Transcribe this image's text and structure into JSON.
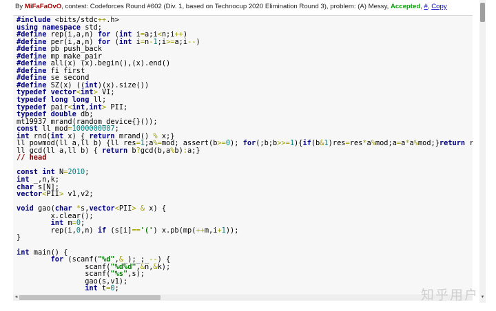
{
  "header": {
    "by_label": "By ",
    "username": "MiFaFaOvO",
    "contest_text": ", contest: Codeforces Round #602 (Div. 1, based on Technocup 2020 Elimination Round 3), problem: (A) Messy, ",
    "verdict": "Accepted",
    "sep1": ", ",
    "hash_link": "#",
    "sep2": ", ",
    "copy_link": "Copy"
  },
  "code_lines": [
    [
      [
        "pp",
        "#include"
      ],
      [
        "t",
        " <bits/stdc"
      ],
      [
        "op",
        "++"
      ],
      [
        "t",
        ".h>"
      ]
    ],
    [
      [
        "kw",
        "using namespace"
      ],
      [
        "t",
        " std;"
      ]
    ],
    [
      [
        "pp",
        "#define"
      ],
      [
        "t",
        " rep(i,a,n) "
      ],
      [
        "kw",
        "for"
      ],
      [
        "t",
        " ("
      ],
      [
        "kw",
        "int"
      ],
      [
        "t",
        " i"
      ],
      [
        "op",
        "="
      ],
      [
        "t",
        "a;i"
      ],
      [
        "op",
        "<"
      ],
      [
        "t",
        "n;i"
      ],
      [
        "op",
        "++"
      ],
      [
        "t",
        ")"
      ]
    ],
    [
      [
        "pp",
        "#define"
      ],
      [
        "t",
        " per(i,a,n) "
      ],
      [
        "kw",
        "for"
      ],
      [
        "t",
        " ("
      ],
      [
        "kw",
        "int"
      ],
      [
        "t",
        " i"
      ],
      [
        "op",
        "="
      ],
      [
        "t",
        "n"
      ],
      [
        "op",
        "-"
      ],
      [
        "num",
        "1"
      ],
      [
        "t",
        ";i"
      ],
      [
        "op",
        ">="
      ],
      [
        "t",
        "a;i"
      ],
      [
        "op",
        "--"
      ],
      [
        "t",
        ")"
      ]
    ],
    [
      [
        "pp",
        "#define"
      ],
      [
        "t",
        " pb push_back"
      ]
    ],
    [
      [
        "pp",
        "#define"
      ],
      [
        "t",
        " mp make_pair"
      ]
    ],
    [
      [
        "pp",
        "#define"
      ],
      [
        "t",
        " all(x) (x).begin(),(x).end()"
      ]
    ],
    [
      [
        "pp",
        "#define"
      ],
      [
        "t",
        " fi first"
      ]
    ],
    [
      [
        "pp",
        "#define"
      ],
      [
        "t",
        " se second"
      ]
    ],
    [
      [
        "pp",
        "#define"
      ],
      [
        "t",
        " SZ(x) (("
      ],
      [
        "kw",
        "int"
      ],
      [
        "t",
        ")(x).size())"
      ]
    ],
    [
      [
        "kw",
        "typedef"
      ],
      [
        "t",
        " "
      ],
      [
        "kw",
        "vector"
      ],
      [
        "op",
        "<"
      ],
      [
        "kw",
        "int"
      ],
      [
        "op",
        ">"
      ],
      [
        "t",
        " VI;"
      ]
    ],
    [
      [
        "kw",
        "typedef"
      ],
      [
        "t",
        " "
      ],
      [
        "kw",
        "long long"
      ],
      [
        "t",
        " ll;"
      ]
    ],
    [
      [
        "kw",
        "typedef"
      ],
      [
        "t",
        " pair"
      ],
      [
        "op",
        "<"
      ],
      [
        "kw",
        "int"
      ],
      [
        "t",
        ","
      ],
      [
        "kw",
        "int"
      ],
      [
        "op",
        ">"
      ],
      [
        "t",
        " PII;"
      ]
    ],
    [
      [
        "kw",
        "typedef"
      ],
      [
        "t",
        " "
      ],
      [
        "kw",
        "double"
      ],
      [
        "t",
        " db;"
      ]
    ],
    [
      [
        "t",
        "mt19937 mrand(random_device{}());"
      ]
    ],
    [
      [
        "kw",
        "const"
      ],
      [
        "t",
        " ll mod"
      ],
      [
        "op",
        "="
      ],
      [
        "num",
        "1000000007"
      ],
      [
        "t",
        ";"
      ]
    ],
    [
      [
        "kw",
        "int"
      ],
      [
        "t",
        " rnd("
      ],
      [
        "kw",
        "int"
      ],
      [
        "t",
        " x) { "
      ],
      [
        "kw",
        "return"
      ],
      [
        "t",
        " mrand() "
      ],
      [
        "op",
        "%"
      ],
      [
        "t",
        " x;}"
      ]
    ],
    [
      [
        "t",
        "ll powmod(ll a,ll b) {ll res"
      ],
      [
        "op",
        "="
      ],
      [
        "num",
        "1"
      ],
      [
        "t",
        ";a"
      ],
      [
        "op",
        "%="
      ],
      [
        "t",
        "mod; assert(b"
      ],
      [
        "op",
        ">="
      ],
      [
        "num",
        "0"
      ],
      [
        "t",
        "); "
      ],
      [
        "kw",
        "for"
      ],
      [
        "t",
        "(;b;b"
      ],
      [
        "op",
        ">>="
      ],
      [
        "num",
        "1"
      ],
      [
        "t",
        "){"
      ],
      [
        "kw",
        "if"
      ],
      [
        "t",
        "(b"
      ],
      [
        "op",
        "&"
      ],
      [
        "num",
        "1"
      ],
      [
        "t",
        ")res"
      ],
      [
        "op",
        "="
      ],
      [
        "t",
        "res"
      ],
      [
        "op",
        "*"
      ],
      [
        "t",
        "a"
      ],
      [
        "op",
        "%"
      ],
      [
        "t",
        "mod;a"
      ],
      [
        "op",
        "="
      ],
      [
        "t",
        "a"
      ],
      [
        "op",
        "*"
      ],
      [
        "t",
        "a"
      ],
      [
        "op",
        "%"
      ],
      [
        "t",
        "mod;}"
      ],
      [
        "kw",
        "return"
      ],
      [
        "t",
        " res;}"
      ]
    ],
    [
      [
        "t",
        "ll gcd(ll a,ll b) { "
      ],
      [
        "kw",
        "return"
      ],
      [
        "t",
        " b"
      ],
      [
        "op",
        "?"
      ],
      [
        "t",
        "gcd(b,a"
      ],
      [
        "op",
        "%"
      ],
      [
        "t",
        "b)"
      ],
      [
        "op",
        ":"
      ],
      [
        "t",
        "a;}"
      ]
    ],
    [
      [
        "cm",
        "// head"
      ]
    ],
    [],
    [
      [
        "kw",
        "const"
      ],
      [
        "t",
        " "
      ],
      [
        "kw",
        "int"
      ],
      [
        "t",
        " N"
      ],
      [
        "op",
        "="
      ],
      [
        "num",
        "2010"
      ],
      [
        "t",
        ";"
      ]
    ],
    [
      [
        "kw",
        "int"
      ],
      [
        "t",
        " _,n,k;"
      ]
    ],
    [
      [
        "kw",
        "char"
      ],
      [
        "t",
        " s[N];"
      ]
    ],
    [
      [
        "kw",
        "vector"
      ],
      [
        "op",
        "<"
      ],
      [
        "t",
        "PII"
      ],
      [
        "op",
        ">"
      ],
      [
        "t",
        " v1,v2;"
      ]
    ],
    [],
    [
      [
        "kw",
        "void"
      ],
      [
        "t",
        " gao("
      ],
      [
        "kw",
        "char"
      ],
      [
        "t",
        " "
      ],
      [
        "op",
        "*"
      ],
      [
        "t",
        "s,"
      ],
      [
        "kw",
        "vector"
      ],
      [
        "op",
        "<"
      ],
      [
        "t",
        "PII"
      ],
      [
        "op",
        ">"
      ],
      [
        "t",
        " "
      ],
      [
        "op",
        "&"
      ],
      [
        "t",
        " x) {"
      ]
    ],
    [
      [
        "t",
        "\tx.clear();"
      ]
    ],
    [
      [
        "t",
        "\t"
      ],
      [
        "kw",
        "int"
      ],
      [
        "t",
        " m"
      ],
      [
        "op",
        "="
      ],
      [
        "num",
        "0"
      ],
      [
        "t",
        ";"
      ]
    ],
    [
      [
        "t",
        "\trep(i,"
      ],
      [
        "num",
        "0"
      ],
      [
        "t",
        ",n) "
      ],
      [
        "kw",
        "if"
      ],
      [
        "t",
        " (s[i]"
      ],
      [
        "op",
        "=="
      ],
      [
        "str",
        "'('"
      ],
      [
        "t",
        ") x.pb(mp("
      ],
      [
        "op",
        "++"
      ],
      [
        "t",
        "m,i"
      ],
      [
        "op",
        "+"
      ],
      [
        "num",
        "1"
      ],
      [
        "t",
        "));"
      ]
    ],
    [
      [
        "t",
        "}"
      ]
    ],
    [],
    [
      [
        "kw",
        "int"
      ],
      [
        "t",
        " main() {"
      ]
    ],
    [
      [
        "t",
        "\t"
      ],
      [
        "kw",
        "for"
      ],
      [
        "t",
        " (scanf("
      ],
      [
        "str",
        "\"%d\""
      ],
      [
        "t",
        ","
      ],
      [
        "op",
        "&"
      ],
      [
        "t",
        "_);_;_"
      ],
      [
        "op",
        "--"
      ],
      [
        "t",
        ") {"
      ]
    ],
    [
      [
        "t",
        "\t\tscanf("
      ],
      [
        "str",
        "\"%d%d\""
      ],
      [
        "t",
        ","
      ],
      [
        "op",
        "&"
      ],
      [
        "t",
        "n,"
      ],
      [
        "op",
        "&"
      ],
      [
        "t",
        "k);"
      ]
    ],
    [
      [
        "t",
        "\t\tscanf("
      ],
      [
        "str",
        "\"%s\""
      ],
      [
        "t",
        ",s);"
      ]
    ],
    [
      [
        "t",
        "\t\tgao(s,v1);"
      ]
    ],
    [
      [
        "t",
        "\t\t"
      ],
      [
        "kw",
        "int"
      ],
      [
        "t",
        " t"
      ],
      [
        "op",
        "="
      ],
      [
        "num",
        "0"
      ],
      [
        "t",
        ";"
      ]
    ]
  ],
  "scrollbar": {
    "left_arrow": "◄",
    "down_arrow": "▼"
  },
  "watermark": "知乎用户"
}
